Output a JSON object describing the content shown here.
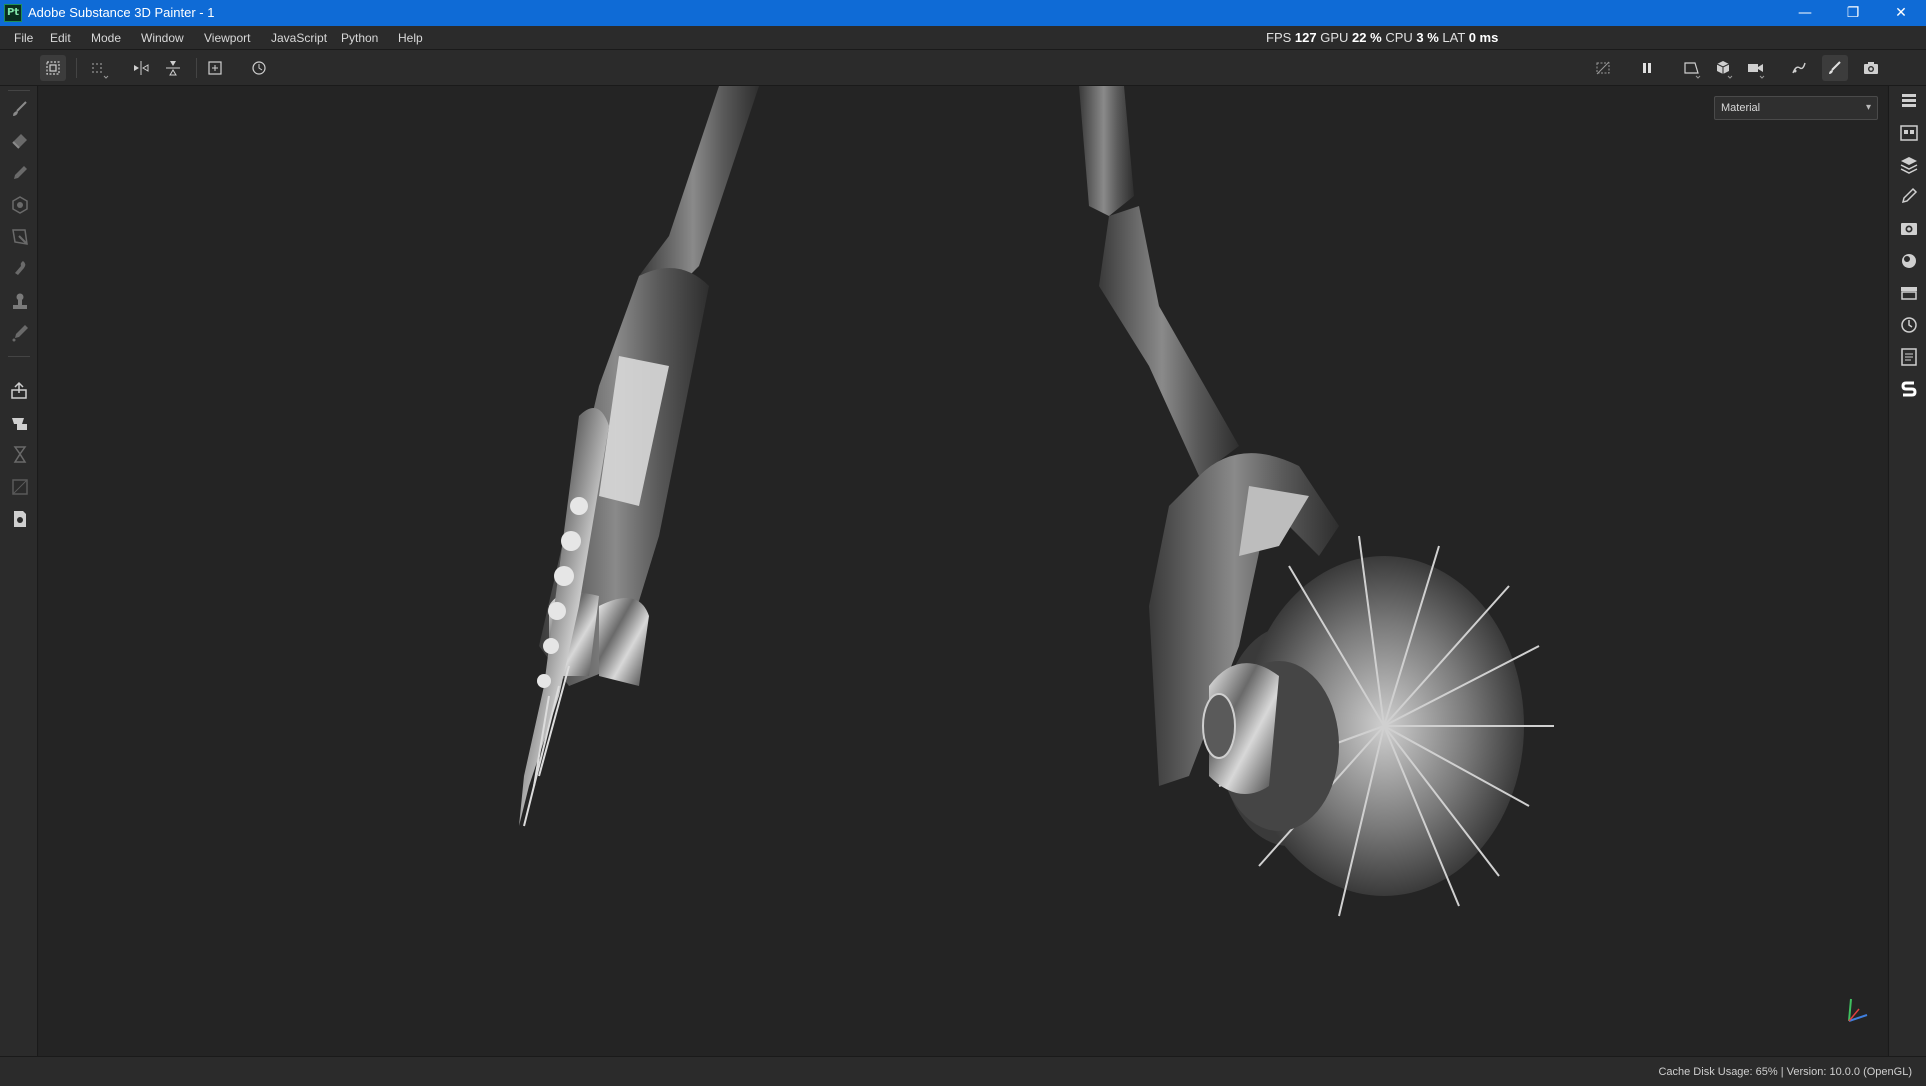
{
  "window": {
    "app_icon_text": "Pt",
    "title": "Adobe Substance 3D Painter - 1",
    "minimize": "—",
    "maximize": "❐",
    "close": "✕"
  },
  "menubar": {
    "items": [
      "File",
      "Edit",
      "Mode",
      "Window",
      "Viewport",
      "JavaScript",
      "Python",
      "Help"
    ]
  },
  "performance": {
    "fps_label": "FPS",
    "fps_value": "127",
    "gpu_label": "GPU",
    "gpu_value": "22 %",
    "cpu_label": "CPU",
    "cpu_value": "3 %",
    "lat_label": "LAT",
    "lat_value": "0 ms"
  },
  "toolbar": {
    "left_icons": [
      "selection-mode-icon",
      "grid-icon",
      "symmetry-x-icon",
      "symmetry-y-icon",
      "add-frame-icon",
      "history-icon"
    ],
    "right_icons": [
      "hide-icon",
      "pause-icon",
      "camera-2d-icon",
      "cube-icon",
      "video-camera-icon",
      "render-icon",
      "paint-brush-icon",
      "screenshot-icon"
    ]
  },
  "left_tools": [
    "paint-brush-icon",
    "eraser-icon",
    "projection-icon",
    "geometry-mask-icon",
    "polygon-fill-icon",
    "smudge-icon",
    "clone-icon",
    "color-picker-icon",
    "export-icon",
    "bake-icon",
    "texture-set-icon",
    "uv-icon",
    "document-icon"
  ],
  "right_panels": [
    "layers-stack-icon",
    "shelf-icon",
    "layers-icon",
    "properties-icon",
    "display-settings-icon",
    "environment-icon",
    "texture-set-list-icon",
    "history-panel-icon",
    "log-icon",
    "substance-icon"
  ],
  "viewport": {
    "channel": "Material"
  },
  "status": {
    "text": "Cache Disk Usage:   65% | Version: 10.0.0 (OpenGL)"
  },
  "colors": {
    "title_bar": "#0f6bd6",
    "chrome": "#2b2b2b",
    "viewport_bg": "#242424"
  }
}
